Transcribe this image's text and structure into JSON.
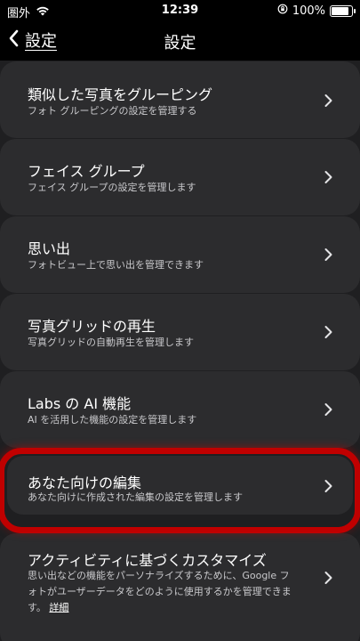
{
  "status_bar": {
    "carrier": "圏外",
    "time": "12:39",
    "battery": "100%",
    "battery_level": 1.0
  },
  "nav": {
    "back_label": "設定",
    "title": "設定"
  },
  "items": [
    {
      "title": "類似した写真をグルーピング",
      "description": "フォト グルーピングの設定を管理する"
    },
    {
      "title": "フェイス グループ",
      "description": "フェイス グループの設定を管理します"
    },
    {
      "title": "思い出",
      "description": "フォトビュー上で思い出を管理できます"
    },
    {
      "title": "写真グリッドの再生",
      "description": "写真グリッドの自動再生を管理します"
    },
    {
      "title": "Labs の AI 機能",
      "description": "AI を活用した機能の設定を管理します"
    },
    {
      "title": "あなた向けの編集",
      "description": "あなた向けに作成された編集の設定を管理します"
    },
    {
      "title": "アクティビティに基づくカスタマイズ",
      "description": "思い出などの機能をパーソナライズするために、Google フォトがユーザーデータをどのように使用するかを管理できます。",
      "link": "詳細"
    }
  ],
  "icons": {
    "back": "chevron-left-icon",
    "chevron": "chevron-right-icon",
    "wifi": "wifi-icon",
    "orientation_lock": "orientation-lock-icon",
    "battery": "battery-icon"
  },
  "colors": {
    "background": "#1f1f21",
    "card": "#2c2c2e",
    "highlight": "#c00000"
  }
}
